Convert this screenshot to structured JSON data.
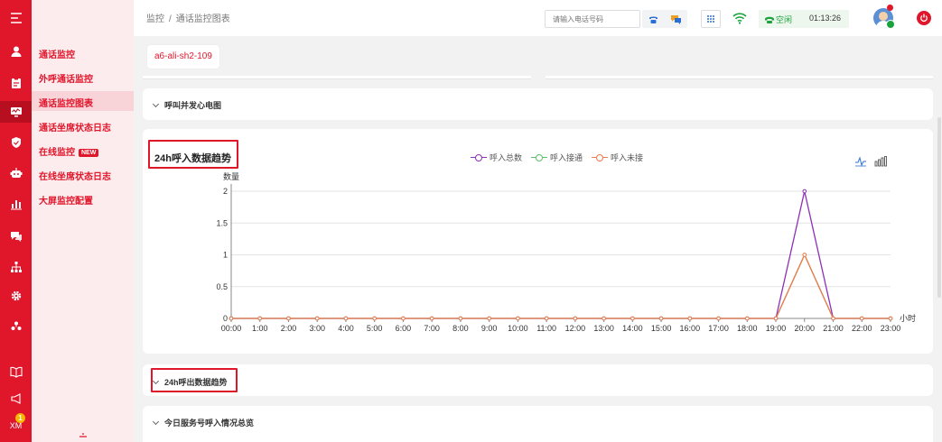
{
  "rail": {
    "badge": "1",
    "user_initials": "XM"
  },
  "subnav": {
    "items": [
      {
        "label": "通话监控",
        "active": false,
        "tag": ""
      },
      {
        "label": "外呼通话监控",
        "active": false,
        "tag": ""
      },
      {
        "label": "通话监控图表",
        "active": true,
        "tag": ""
      },
      {
        "label": "通话坐席状态日志",
        "active": false,
        "tag": ""
      },
      {
        "label": "在线监控",
        "active": false,
        "tag": "NEW"
      },
      {
        "label": "在线坐席状态日志",
        "active": false,
        "tag": ""
      },
      {
        "label": "大屏监控配置",
        "active": false,
        "tag": ""
      }
    ]
  },
  "topbar": {
    "breadcrumb": [
      "监控",
      "通话监控图表"
    ],
    "breadcrumb_sep": "/",
    "phone_placeholder": "请输入电话号码",
    "status": "空闲",
    "timer": "01:13:26"
  },
  "tabs": [
    "a6-ali-sh2-109"
  ],
  "panels": {
    "heart": "呼叫并发心电图",
    "outbound": "24h呼出数据趋势",
    "service": "今日服务号呼入情况总览"
  },
  "colors": {
    "brand": "#e0162b",
    "series_total": "#8e2fb5",
    "series_answered": "#5cc26a",
    "series_missed": "#ee7b4f"
  },
  "chart_data": {
    "type": "line",
    "title": "24h呼入数据趋势",
    "ylabel": "数量",
    "xlabel": "小时",
    "ylim": [
      0,
      2
    ],
    "yticks": [
      "0",
      "0.5",
      "1",
      "1.5",
      "2"
    ],
    "x": [
      "00:00",
      "1:00",
      "2:00",
      "3:00",
      "4:00",
      "5:00",
      "6:00",
      "7:00",
      "8:00",
      "9:00",
      "10:00",
      "11:00",
      "12:00",
      "13:00",
      "14:00",
      "15:00",
      "16:00",
      "17:00",
      "18:00",
      "19:00",
      "20:00",
      "21:00",
      "22:00",
      "23:00"
    ],
    "legend_position": "top-center",
    "grid": true,
    "series": [
      {
        "name": "呼入总数",
        "color": "#8e2fb5",
        "values": [
          0,
          0,
          0,
          0,
          0,
          0,
          0,
          0,
          0,
          0,
          0,
          0,
          0,
          0,
          0,
          0,
          0,
          0,
          0,
          0,
          2,
          0,
          0,
          0
        ]
      },
      {
        "name": "呼入接通",
        "color": "#5cc26a",
        "values": [
          0,
          0,
          0,
          0,
          0,
          0,
          0,
          0,
          0,
          0,
          0,
          0,
          0,
          0,
          0,
          0,
          0,
          0,
          0,
          0,
          1,
          0,
          0,
          0
        ]
      },
      {
        "name": "呼入未接",
        "color": "#ee7b4f",
        "values": [
          0,
          0,
          0,
          0,
          0,
          0,
          0,
          0,
          0,
          0,
          0,
          0,
          0,
          0,
          0,
          0,
          0,
          0,
          0,
          0,
          1,
          0,
          0,
          0
        ]
      }
    ]
  }
}
